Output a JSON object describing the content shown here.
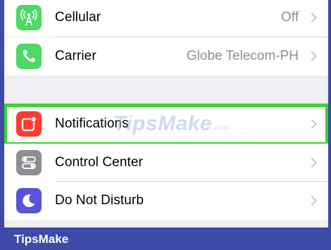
{
  "settings": {
    "rows": [
      {
        "label": "Cellular",
        "value": "Off",
        "icon": "cellular-antenna-icon",
        "color": "#4cd964"
      },
      {
        "label": "Carrier",
        "value": "Globe Telecom-PH",
        "icon": "phone-icon",
        "color": "#4cd964"
      },
      {
        "label": "Notifications",
        "value": "",
        "icon": "notifications-icon",
        "color": "#ff3b30",
        "highlighted": true
      },
      {
        "label": "Control Center",
        "value": "",
        "icon": "control-center-icon",
        "color": "#8e8e93"
      },
      {
        "label": "Do Not Disturb",
        "value": "",
        "icon": "moon-icon",
        "color": "#5856d6"
      }
    ]
  },
  "watermark": {
    "text": "TipsMake",
    "suffix": ".com"
  },
  "brand": {
    "text": "TipsMake"
  },
  "colors": {
    "highlight": "#38d62c",
    "footer": "#3d4aa8",
    "background": "#efeff4"
  }
}
